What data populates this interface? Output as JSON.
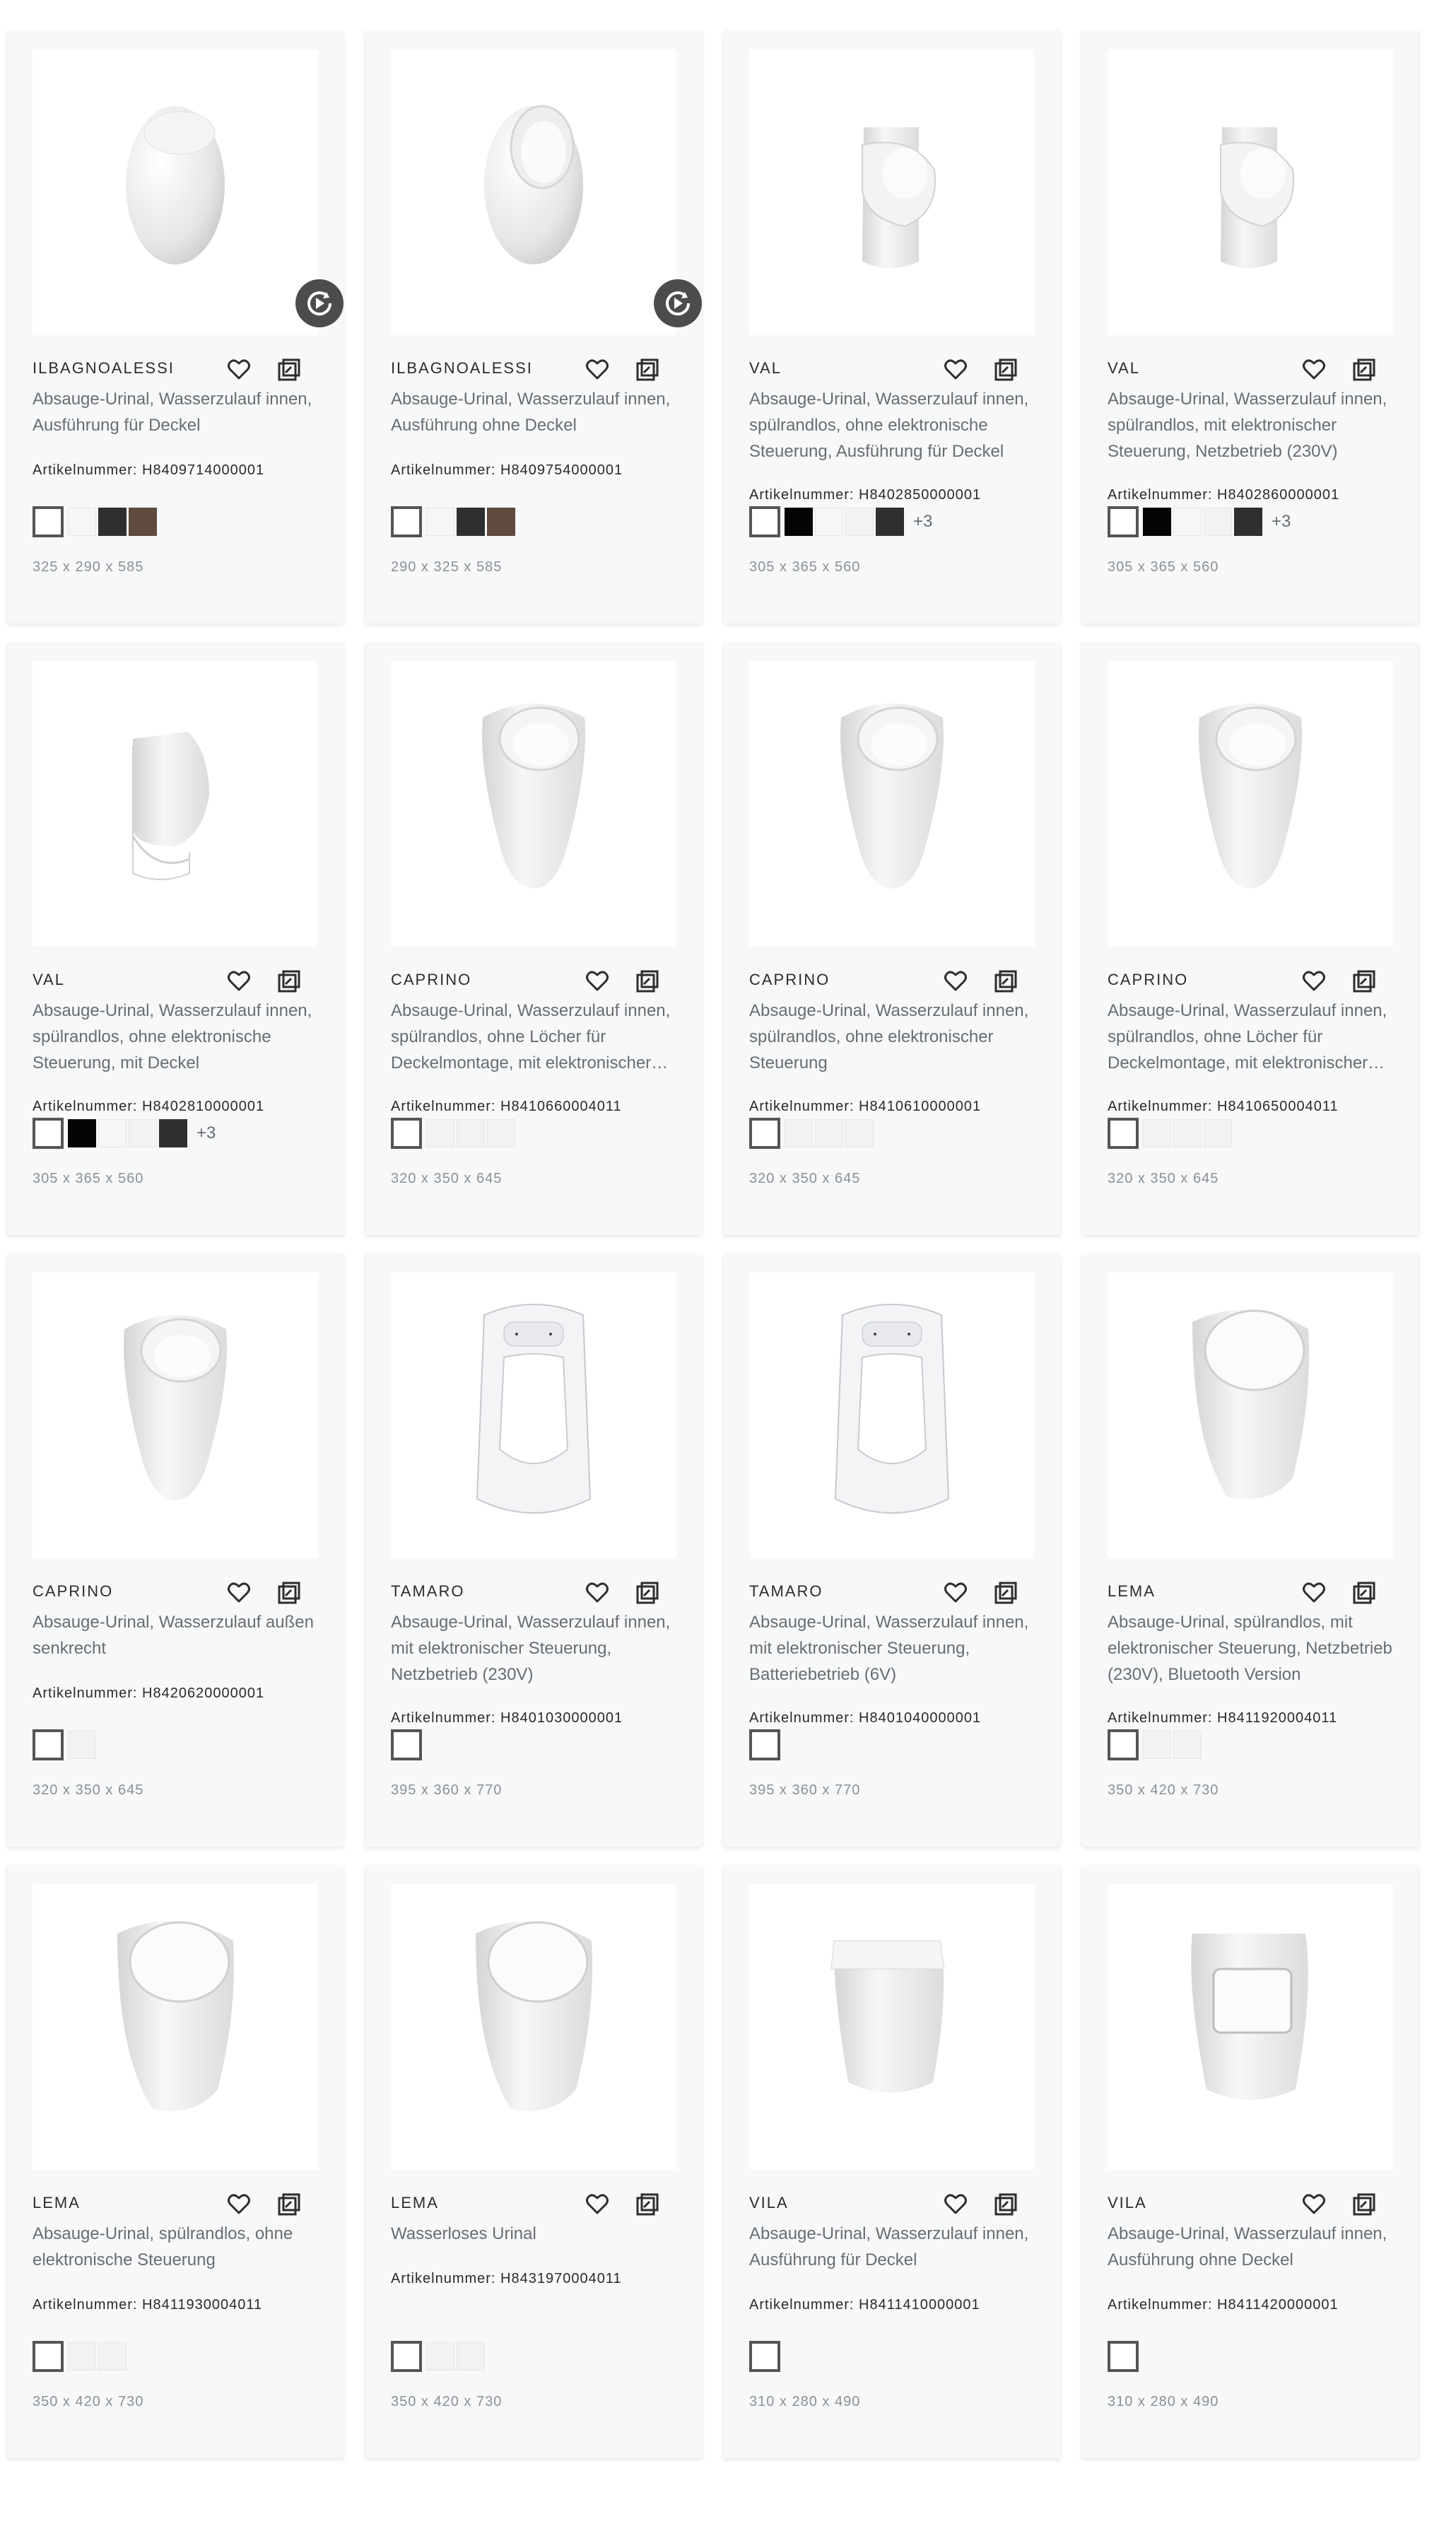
{
  "labels": {
    "article_prefix": "Artikelnummer: "
  },
  "colors": {
    "white": "#f6f6f6",
    "black": "#050505",
    "anthracite": "#2f2f2f",
    "brown": "#5e4a3e",
    "offwhite": "#f2f2f2"
  },
  "products": [
    {
      "brand": "ILBAGNOALESSI",
      "desc": "Absauge-Urinal, Wasserzulauf innen, Ausführung für Deckel",
      "article": "Artikelnummer: H8409714000001",
      "swatches": [
        "white",
        "anthracite",
        "brown"
      ],
      "more": "",
      "dims": "325 x 290 x 585",
      "shape": "egg-closed",
      "play": true,
      "lines": 2
    },
    {
      "brand": "ILBAGNOALESSI",
      "desc": "Absauge-Urinal, Wasserzulauf innen, Ausführung ohne Deckel",
      "article": "Artikelnummer: H8409754000001",
      "swatches": [
        "white",
        "anthracite",
        "brown"
      ],
      "more": "",
      "dims": "290 x 325 x 585",
      "shape": "egg-open",
      "play": true,
      "lines": 2
    },
    {
      "brand": "VAL",
      "desc": "Absauge-Urinal, Wasserzulauf innen, spülrandlos, ohne elektronische Steuerung, Ausführung für Deckel",
      "article": "Artikelnummer: H8402850000001",
      "swatches": [
        "black",
        "white",
        "offwhite",
        "anthracite"
      ],
      "more": "+3",
      "dims": "305 x 365 x 560",
      "shape": "val",
      "play": false,
      "lines": 3
    },
    {
      "brand": "VAL",
      "desc": "Absauge-Urinal, Wasserzulauf innen, spülrandlos, mit elektronischer Steuerung, Netzbetrieb (230V)",
      "article": "Artikelnummer: H8402860000001",
      "swatches": [
        "black",
        "white",
        "offwhite",
        "anthracite"
      ],
      "more": "+3",
      "dims": "305 x 365 x 560",
      "shape": "val",
      "play": false,
      "lines": 3
    },
    {
      "brand": "VAL",
      "desc": "Absauge-Urinal, Wasserzulauf innen, spülrandlos, ohne elektronische Steuerung, mit Deckel",
      "article": "Artikelnummer: H8402810000001",
      "swatches": [
        "black",
        "white",
        "offwhite",
        "anthracite"
      ],
      "more": "+3",
      "dims": "305 x 365 x 560",
      "shape": "val-lid",
      "play": false,
      "lines": 3
    },
    {
      "brand": "CAPRINO",
      "desc": "Absauge-Urinal, Wasserzulauf innen, spülrandlos, ohne Löcher für Deckelmontage, mit elektronischer Steuerung",
      "article": "Artikelnummer: H8410660004011",
      "swatches": [
        "offwhite",
        "offwhite",
        "offwhite"
      ],
      "more": "",
      "dims": "320 x 350 x 645",
      "shape": "caprino",
      "play": false,
      "lines": 3
    },
    {
      "brand": "CAPRINO",
      "desc": "Absauge-Urinal, Wasserzulauf innen, spülrandlos, ohne elektronischer Steuerung",
      "article": "Artikelnummer: H8410610000001",
      "swatches": [
        "offwhite",
        "offwhite",
        "offwhite"
      ],
      "more": "",
      "dims": "320 x 350 x 645",
      "shape": "caprino",
      "play": false,
      "lines": 3
    },
    {
      "brand": "CAPRINO",
      "desc": "Absauge-Urinal, Wasserzulauf innen, spülrandlos, ohne Löcher für Deckelmontage, mit elektronischer Steuerung",
      "article": "Artikelnummer: H8410650004011",
      "swatches": [
        "offwhite",
        "offwhite",
        "offwhite"
      ],
      "more": "",
      "dims": "320 x 350 x 645",
      "shape": "caprino",
      "play": false,
      "lines": 3
    },
    {
      "brand": "CAPRINO",
      "desc": "Absauge-Urinal, Wasserzulauf außen senkrecht",
      "article": "Artikelnummer: H8420620000001",
      "swatches": [
        "offwhite"
      ],
      "more": "",
      "dims": "320 x 350 x 645",
      "shape": "caprino",
      "play": false,
      "lines": 2
    },
    {
      "brand": "TAMARO",
      "desc": "Absauge-Urinal, Wasserzulauf innen, mit elektronischer Steuerung, Netzbetrieb (230V)",
      "article": "Artikelnummer: H8401030000001",
      "swatches": [],
      "more": "",
      "dims": "395 x 360 x 770",
      "shape": "tamaro",
      "play": false,
      "lines": 3
    },
    {
      "brand": "TAMARO",
      "desc": "Absauge-Urinal, Wasserzulauf innen, mit elektronischer Steuerung, Batteriebetrieb (6V)",
      "article": "Artikelnummer: H8401040000001",
      "swatches": [],
      "more": "",
      "dims": "395 x 360 x 770",
      "shape": "tamaro",
      "play": false,
      "lines": 3
    },
    {
      "brand": "LEMA",
      "desc": "Absauge-Urinal, spülrandlos, mit elektronischer Steuerung, Netzbetrieb (230V), Bluetooth Version",
      "article": "Artikelnummer: H8411920004011",
      "swatches": [
        "offwhite",
        "offwhite"
      ],
      "more": "",
      "dims": "350 x 420 x 730",
      "shape": "lema",
      "play": false,
      "lines": 3
    },
    {
      "brand": "LEMA",
      "desc": "Absauge-Urinal, spülrandlos, ohne elektronische Steuerung",
      "article": "Artikelnummer: H8411930004011",
      "swatches": [
        "offwhite",
        "offwhite"
      ],
      "more": "",
      "dims": "350 x 420 x 730",
      "shape": "lema",
      "play": false,
      "lines": 2
    },
    {
      "brand": "LEMA",
      "desc": "Wasserloses Urinal",
      "article": "Artikelnummer: H8431970004011",
      "swatches": [
        "offwhite",
        "offwhite"
      ],
      "more": "",
      "dims": "350 x 420 x 730",
      "shape": "lema",
      "play": false,
      "lines": 1
    },
    {
      "brand": "VILA",
      "desc": "Absauge-Urinal, Wasserzulauf innen, Ausführung für Deckel",
      "article": "Artikelnummer: H8411410000001",
      "swatches": [],
      "more": "",
      "dims": "310 x 280 x 490",
      "shape": "vila",
      "play": false,
      "lines": 2
    },
    {
      "brand": "VILA",
      "desc": "Absauge-Urinal, Wasserzulauf innen, Ausführung ohne Deckel",
      "article": "Artikelnummer: H8411420000001",
      "swatches": [],
      "more": "",
      "dims": "310 x 280 x 490",
      "shape": "vila-open",
      "play": false,
      "lines": 2
    }
  ]
}
